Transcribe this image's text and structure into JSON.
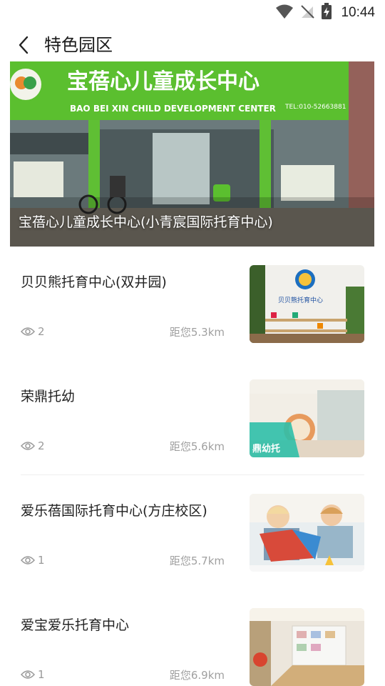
{
  "status_bar": {
    "time": "10:44"
  },
  "header": {
    "title": "特色园区"
  },
  "banner": {
    "caption": "宝蓓心儿童成长中心(小青宸国际托育中心)",
    "sign_cn": "宝蓓心儿童成长中心",
    "sign_en": "BAO BEI XIN CHILD DEVELOPMENT CENTER",
    "sign_tel": "TEL:010-52663881"
  },
  "centers": [
    {
      "name": "贝贝熊托育中心(双井园)",
      "views": "2",
      "distance": "距您5.3km",
      "thumb_text": "贝贝熊托育中心"
    },
    {
      "name": "荣鼎托幼",
      "views": "2",
      "distance": "距您5.6km",
      "thumb_text": "鼎幼托"
    },
    {
      "name": "爱乐蓓国际托育中心(方庄校区)",
      "views": "1",
      "distance": "距您5.7km",
      "thumb_text": ""
    },
    {
      "name": "爱宝爱乐托育中心",
      "views": "1",
      "distance": "距您6.9km",
      "thumb_text": ""
    }
  ],
  "colors": {
    "brand_green": "#5bbf2f",
    "meta_gray": "#9a9a9a"
  }
}
